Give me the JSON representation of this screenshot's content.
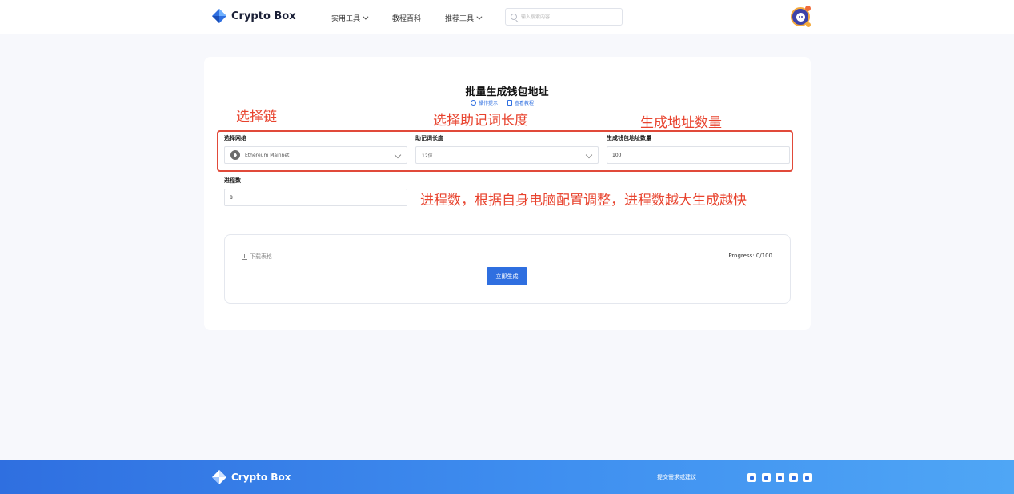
{
  "header": {
    "brand": "Crypto Box",
    "nav": [
      {
        "label": "实用工具",
        "dropdown": true
      },
      {
        "label": "教程百科",
        "dropdown": false
      },
      {
        "label": "推荐工具",
        "dropdown": true
      }
    ],
    "search": {
      "placeholder": "输入搜索内容",
      "value": ""
    }
  },
  "page": {
    "title": "批量生成钱包地址",
    "links": [
      "操作提示",
      "查看教程"
    ]
  },
  "form": {
    "network": {
      "label": "选择网络",
      "value": "Ethereum Mainnet"
    },
    "mnemonic_length": {
      "label": "助记词长度",
      "value": "12位"
    },
    "address_count": {
      "label": "生成钱包地址数量",
      "value": "100"
    },
    "process_count": {
      "label": "进程数",
      "value": "8"
    }
  },
  "annotations": {
    "chain": "选择链",
    "mnemonic": "选择助记词长度",
    "count": "生成地址数量",
    "process": "进程数，根据自身电脑配置调整，进程数越大生成越快",
    "color": "#e8432e"
  },
  "generator": {
    "download_label": "下载表格",
    "progress": "Progress: 0/100",
    "button_label": "立即生成"
  },
  "footer": {
    "brand": "Crypto Box",
    "feedback": "提交需求或建议",
    "social_icons": [
      "wechat-icon",
      "weibo-icon",
      "telegram-icon",
      "twitter-icon",
      "discord-icon"
    ]
  },
  "colors": {
    "accent": "#2f6fe0",
    "annotation": "#e8432e"
  }
}
